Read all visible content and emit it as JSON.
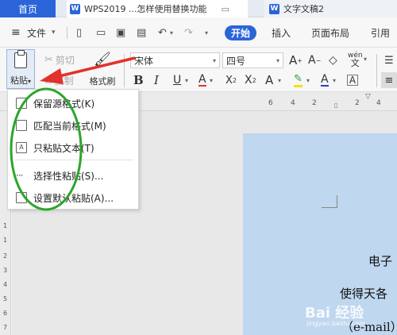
{
  "tabs": {
    "home": "首页",
    "doc1": "WPS2019 ...怎样使用替换功能",
    "doc2": "文字文稿2"
  },
  "menubar": {
    "file": "文件",
    "start": "开始",
    "insert": "插入",
    "layout": "页面布局",
    "reference": "引用"
  },
  "ribbon": {
    "paste": "粘贴",
    "cut": "剪切",
    "copy": "复制",
    "format_painter": "格式刷",
    "font_name": "宋体",
    "font_size": "四号",
    "pinyin": "wén"
  },
  "ruler": {
    "top_numbers": [
      "6",
      "4",
      "2",
      "2",
      "4"
    ],
    "left_numbers": [
      "1",
      "1",
      "2",
      "3",
      "4",
      "5",
      "6",
      "7"
    ]
  },
  "paste_menu": {
    "items": [
      {
        "label": "保留源格式(K)"
      },
      {
        "label": "匹配当前格式(M)"
      },
      {
        "label": "只粘贴文本(T)"
      },
      {
        "label": "选择性粘贴(S)..."
      },
      {
        "label": "设置默认粘贴(A)..."
      }
    ]
  },
  "document": {
    "line1": "电子",
    "line2": "使得天各",
    "line3": "（e-mail）"
  },
  "watermark": {
    "text": "Bai 经验",
    "sub": "jingyan.baidu.com"
  },
  "colors": {
    "accent": "#2b64d8",
    "page_bg": "#bfd7ef",
    "annotation_red": "#e3312b",
    "annotation_green": "#2aa62a"
  }
}
